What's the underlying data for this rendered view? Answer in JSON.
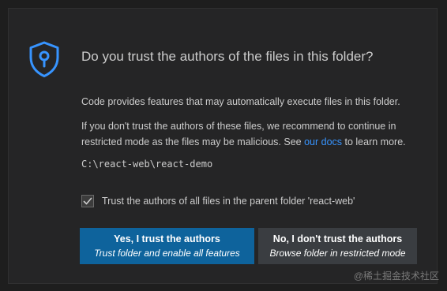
{
  "dialog": {
    "title": "Do you trust the authors of the files in this folder?",
    "paragraph1": "Code provides features that may automatically execute files in this folder.",
    "paragraph2_prefix": "If you don't trust the authors of these files, we recommend to continue in restricted mode as the files may be malicious. See ",
    "paragraph2_link": "our docs",
    "paragraph2_suffix": " to learn more.",
    "folder_path": "C:\\react-web\\react-demo",
    "checkbox": {
      "label": "Trust the authors of all files in the parent folder 'react-web'",
      "checked": true
    },
    "buttons": {
      "trust_main": "Yes, I trust the authors",
      "trust_sub": "Trust folder and enable all features",
      "distrust_main": "No, I don't trust the authors",
      "distrust_sub": "Browse folder in restricted mode"
    }
  },
  "watermark": "@稀土掘金技术社区",
  "colors": {
    "primary_button": "#0e639c",
    "secondary_button": "#3a3d41",
    "link": "#3794ff",
    "shield": "#3794ff",
    "dialog_background": "#252526"
  },
  "icons": {
    "shield": "shield-lock-icon",
    "check": "check-icon"
  }
}
